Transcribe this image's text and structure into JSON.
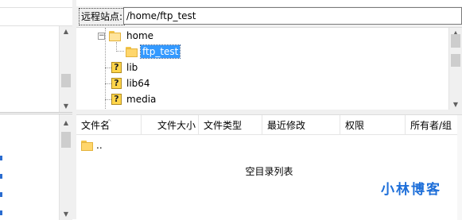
{
  "remote_site": {
    "label": "远程站点:",
    "path": "/home/ftp_test"
  },
  "tree": {
    "items": [
      {
        "label": "home",
        "icon": "folder-open-icon",
        "expander": "−"
      },
      {
        "label": "ftp_test",
        "icon": "folder-icon",
        "selected": true
      },
      {
        "label": "lib",
        "icon": "question-icon"
      },
      {
        "label": "lib64",
        "icon": "question-icon"
      },
      {
        "label": "media",
        "icon": "question-icon"
      }
    ],
    "question_glyph": "?"
  },
  "file_list": {
    "columns": [
      "文件名",
      "文件大小",
      "文件类型",
      "最近修改",
      "权限",
      "所有者/组"
    ],
    "parent_entry": "..",
    "empty_message": "空目录列表"
  },
  "watermark": "小林博客",
  "colors": {
    "selection": "#3399ff",
    "folder": "#ffd66b",
    "watermark": "#1e6fd9"
  }
}
